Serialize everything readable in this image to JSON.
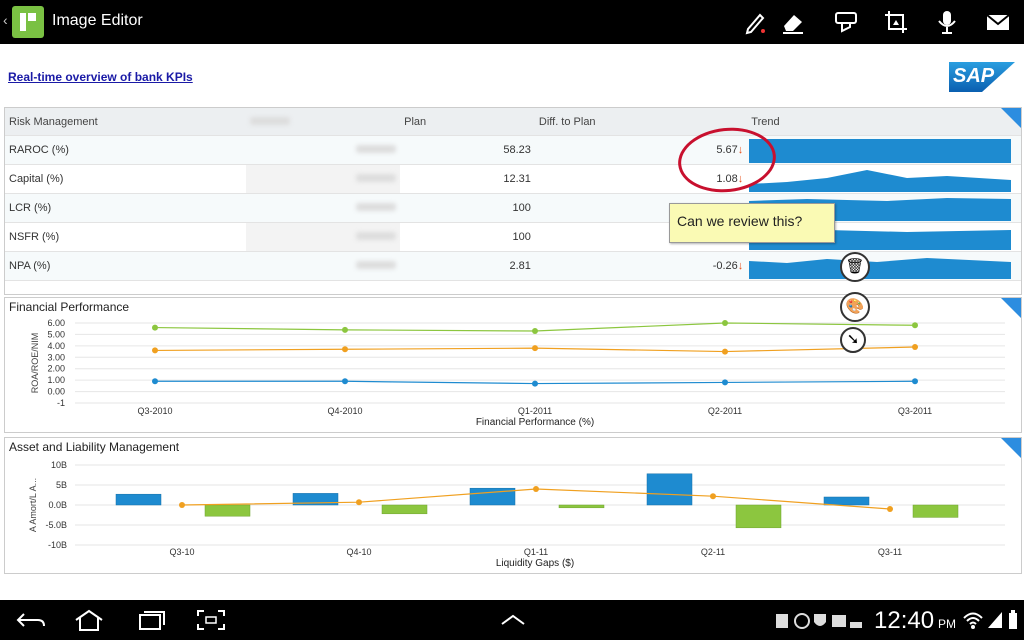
{
  "app": {
    "title": "Image Editor"
  },
  "toolbar": {
    "icons": [
      "pen-icon",
      "eraser-icon",
      "stamp-icon",
      "crop-icon",
      "mic-icon",
      "mail-icon"
    ]
  },
  "page": {
    "link": "Real-time overview of bank KPIs",
    "logo": "SAP"
  },
  "table": {
    "headers": [
      "Risk Management",
      "",
      "Plan",
      "Diff. to Plan",
      "Trend"
    ],
    "rows": [
      {
        "name": "RAROC (%)",
        "plan": "58.23",
        "diff": "5.67",
        "arrow": "down"
      },
      {
        "name": "Capital (%)",
        "plan": "12.31",
        "diff": "1.08",
        "arrow": "down"
      },
      {
        "name": "LCR (%)",
        "plan": "100",
        "diff": "",
        "arrow": ""
      },
      {
        "name": "NSFR (%)",
        "plan": "100",
        "diff": "",
        "arrow": ""
      },
      {
        "name": "NPA (%)",
        "plan": "2.81",
        "diff": "-0.26",
        "arrow": "down"
      }
    ]
  },
  "note": {
    "text": "Can we review this?"
  },
  "colors": {
    "accent": "#2c8de0",
    "green": "#8cc63f",
    "orange": "#f0a020",
    "blue": "#1e8bd0",
    "circle": "#c8102e"
  },
  "chart_data": [
    {
      "type": "line",
      "title": "Financial Performance",
      "xlabel": "Financial Performance (%)",
      "ylabel": "ROA/ROE/NIM",
      "ylim": [
        -1,
        6
      ],
      "yticks": [
        "6.00",
        "5.00",
        "4.00",
        "3.00",
        "2.00",
        "1.00",
        "0.00",
        "-1"
      ],
      "categories": [
        "Q3-2010",
        "Q4-2010",
        "Q1-2011",
        "Q2-2011",
        "Q3-2011"
      ],
      "series": [
        {
          "values": [
            5.6,
            5.4,
            5.3,
            6.0,
            5.8
          ],
          "color": "#8cc63f"
        },
        {
          "values": [
            3.6,
            3.7,
            3.8,
            3.5,
            3.9
          ],
          "color": "#f0a020"
        },
        {
          "values": [
            0.9,
            0.9,
            0.7,
            0.8,
            0.9
          ],
          "color": "#1e8bd0"
        }
      ]
    },
    {
      "type": "bar",
      "title": "Asset and Liability Management",
      "xlabel": "Liquidity Gaps ($)",
      "ylabel": "A Amort/L A...",
      "ylim": [
        -10,
        10
      ],
      "yticks": [
        "10B",
        "5B",
        "0.0B",
        "-5.0B",
        "-10B"
      ],
      "categories": [
        "Q3-10",
        "Q4-10",
        "Q1-11",
        "Q2-11",
        "Q3-11"
      ],
      "series": [
        {
          "values": [
            2.7,
            2.9,
            4.2,
            7.8,
            2.0
          ],
          "color": "#1e8bd0"
        },
        {
          "values": [
            -2.8,
            -2.2,
            -0.7,
            -5.7,
            -3.1
          ],
          "color": "#8cc63f"
        },
        {
          "type": "line",
          "values": [
            0.0,
            0.7,
            4.0,
            2.2,
            -1.0
          ],
          "color": "#f0a020"
        }
      ]
    }
  ],
  "status": {
    "time": "12:40",
    "ampm": "PM"
  }
}
